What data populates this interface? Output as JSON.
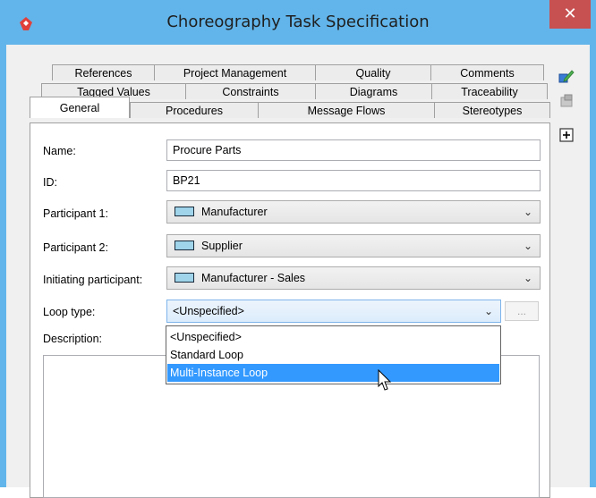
{
  "window": {
    "title": "Choreography Task Specification",
    "close_glyph": "✕",
    "accent_color": "#62b5ea",
    "close_color": "#c75050"
  },
  "tabs": {
    "row1": [
      "References",
      "Project Management",
      "Quality",
      "Comments"
    ],
    "row2": [
      "Tagged Values",
      "Constraints",
      "Diagrams",
      "Traceability"
    ],
    "row3": [
      "General",
      "Procedures",
      "Message Flows",
      "Stereotypes"
    ],
    "active": "General"
  },
  "side_icons": [
    "edit-icon",
    "shape-icon",
    "add-icon"
  ],
  "form": {
    "name_label": "Name:",
    "name_value": "Procure Parts",
    "id_label": "ID:",
    "id_value": "BP21",
    "participant1_label": "Participant 1:",
    "participant1_value": "Manufacturer",
    "participant2_label": "Participant 2:",
    "participant2_value": "Supplier",
    "initiating_label": "Initiating participant:",
    "initiating_value": "Manufacturer - Sales",
    "loop_label": "Loop type:",
    "loop_value": "<Unspecified>",
    "dots_label": "...",
    "description_label": "Description:"
  },
  "loop_dropdown": {
    "options": [
      "<Unspecified>",
      "Standard Loop",
      "Multi-Instance Loop"
    ],
    "highlighted": "Multi-Instance Loop",
    "highlight_color": "#3399ff"
  }
}
